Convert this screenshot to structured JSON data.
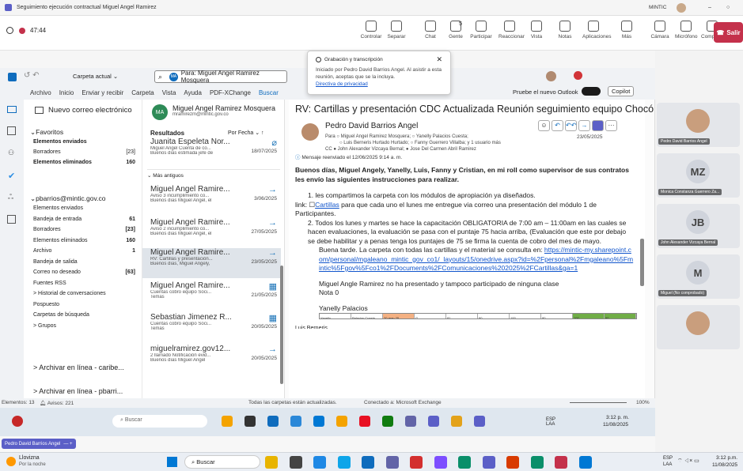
{
  "window_title": "Seguimiento ejecución contractual Miguel Angel Ramirez",
  "window_controls": {
    "app": "MINTIC",
    "min": "–",
    "close": "○"
  },
  "call_timer": "47:44",
  "toolbar": [
    {
      "label": "Controlar",
      "icon": "control-icon"
    },
    {
      "label": "Separar",
      "icon": "pop-out-icon"
    },
    {
      "label": "Chat",
      "icon": "chat-icon"
    },
    {
      "label": "Gente",
      "icon": "people-icon"
    },
    {
      "label": "Participar",
      "icon": "raise-hand-icon"
    },
    {
      "label": "Reaccionar",
      "icon": "react-icon"
    },
    {
      "label": "Vista",
      "icon": "view-icon"
    },
    {
      "label": "Notas",
      "icon": "notes-icon"
    },
    {
      "label": "Aplicaciones",
      "icon": "apps-icon"
    },
    {
      "label": "Más",
      "icon": "more-icon"
    },
    {
      "label": "Cámara",
      "icon": "camera-icon"
    },
    {
      "label": "Micrófono",
      "icon": "mic-icon"
    },
    {
      "label": "Comparte",
      "icon": "share-icon"
    }
  ],
  "people_count": "5",
  "leave_label": "Salir",
  "toast": {
    "title": "Grabación y transcripción",
    "body": "Iniciado por Pedro David Barrios Angel. Al asistir a esta reunión, aceptas que se la incluya.",
    "link": "Directiva de privacidad"
  },
  "outlook": {
    "folder_selector": "Carpeta actual",
    "search_chip": "Para: Miguel Angel Ramirez Mosquera",
    "menu": [
      "Archivo",
      "Inicio",
      "Enviar y recibir",
      "Carpeta",
      "Vista",
      "Ayuda",
      "PDF-XChange",
      "Buscar"
    ],
    "try_new": "Pruebe el nuevo Outlook",
    "copilot": "Copilot",
    "new_mail": "Nuevo correo electrónico",
    "favorites_header": "Favoritos",
    "favorites": [
      {
        "name": "Elementos enviados",
        "count": "",
        "bold": true
      },
      {
        "name": "Borradores",
        "count": "[23]",
        "bold": false
      },
      {
        "name": "Elementos eliminados",
        "count": "160",
        "bold": true
      }
    ],
    "account_header": "pbarrios@mintic.gov.co",
    "account_folders": [
      {
        "name": "Elementos enviados",
        "count": ""
      },
      {
        "name": "Bandeja de entrada",
        "count": "61"
      },
      {
        "name": "Borradores",
        "count": "[23]"
      },
      {
        "name": "Elementos eliminados",
        "count": "160"
      },
      {
        "name": "Archivo",
        "count": "1"
      },
      {
        "name": "Bandeja de salida",
        "count": ""
      },
      {
        "name": "Correo no deseado",
        "count": "[63]"
      },
      {
        "name": "Fuentes RSS",
        "count": ""
      },
      {
        "name": "> Historial de conversaciones",
        "count": ""
      },
      {
        "name": "Pospuesto",
        "count": ""
      },
      {
        "name": "Carpetas de búsqueda",
        "count": ""
      },
      {
        "name": "> Grupos",
        "count": ""
      }
    ],
    "archive_links": [
      "> Archivar en línea - caribe...",
      "> Archivar en línea - pbarri..."
    ],
    "contact_card": {
      "initials": "MA",
      "name": "Miguel Angel Ramirez Mosquera",
      "email": "mramirezm@mintic.gov.co"
    },
    "results_label": "Resultados",
    "sort_label": "Por Fecha",
    "older_label": "Más antiguos",
    "messages": [
      {
        "from": "Juanita Espeleta Nor...",
        "subject": "Miguel Angel Cuenta de co...",
        "preview": "Buenos días estimada jefe de",
        "date": "18/07/2025",
        "icon": "attachment-icon"
      },
      {
        "from": "Miguel Angel Ramire...",
        "subject": "Aviso 3 incumplimiento co...",
        "preview": "Buenos días Miguel Angel, el",
        "date": "3/06/2025",
        "icon": "forward-icon"
      },
      {
        "from": "Miguel Angel Ramire...",
        "subject": "Aviso 2 incumplimiento co...",
        "preview": "Buenos días Miguel Angel, el",
        "date": "27/05/2025",
        "icon": "forward-icon"
      },
      {
        "from": "Miguel Angel Ramire...",
        "subject": "RV: Cartillas y presentación...",
        "preview": "Buenos días, Miguel Angely,",
        "date": "23/05/2025",
        "icon": "forward-icon"
      },
      {
        "from": "Miguel Angel Ramire...",
        "subject": "Cuentas cobro equipo Soci...",
        "preview": "Temas",
        "date": "21/05/2025",
        "icon": "calendar-icon"
      },
      {
        "from": "Sebastian Jimenez R...",
        "subject": "Cuentas cobro equipo Soci...",
        "preview": "Temas",
        "date": "20/05/2025",
        "icon": "calendar-icon"
      },
      {
        "from": "miguelramirez.gov12...",
        "subject": "2 llamado Notificación evid...",
        "preview": "Buenos días Miguel Angel",
        "date": "20/05/2025",
        "icon": "forward-icon"
      }
    ],
    "reading": {
      "subject": "RV: Cartillas y presentación CDC Actualizada Reunión seguimiento equipo Chocó",
      "sender": "Pedro David Barrios Angel",
      "to": "Para  ○ Miguel Angel Ramirez Mosquera; ○ Yanelly Palacios Cuesta;",
      "to2": "○ Luis Berneris Hurtado Hurtado; ○ Fanny Guerrero Villalba; y 1 usuario más",
      "cc": "CC  ● John Alexander Vizcaya Bernal; ● Jose Del Carmen Abril Ramirez",
      "date": "23/05/2025",
      "forwarded": "Mensaje reenviado el 12/06/2025 9:14 a. m.",
      "greeting": "Buenos días, Miguel Angely, Yanelly, Luis, Fanny y Cristian, en mi roll como supervisor de sus contratos les envío las siguientes instrucciones para realizar.",
      "item1": "1.   les compartimos la carpeta con los módulos de apropiación ya diseñados.",
      "link_prefix": "link: ",
      "link_text": "Cartillas",
      "link_suffix": " para que cada uno el lunes me entregue via correo una presentación del módulo 1 de Participantes.",
      "item2": "2.   Todos los lunes y martes se hace la capacitación OBLIGATORIA de 7:00 am – 11:00am en las cuales se hacen evaluaciones, la evaluación se pasa con el puntaje 75 hacia arriba, (Evaluación que este por debajo se debe habilitar y a penas tenga los puntajes de 75 se firma la cuenta de cobro del mes de mayo.",
      "afternoon": "Buena tarde. La carpeta con todas las cartillas y el material se consulta en: ",
      "url": "https://mintic-my.sharepoint.com/personal/mgaleano_mintic_gov_co1/_layouts/15/onedrive.aspx?id=%2Fpersonal%2Fmgaleano%5Fmintic%5Fgov%5Fco1%2FDocuments%2FComunicaciones%202025%2FCartillas&ga=1",
      "no_presented": "Miguel Angle Ramirez no ha presentado y tampoco participado de ninguna clase",
      "grade": "Nota 0",
      "yanelly": "Yanelly Palacios",
      "luis": "Luis Berneris",
      "mini_table": [
        "Yanelly",
        "Palacios Cuesta",
        "20-may-25",
        "G",
        "81",
        "90",
        "100",
        "80",
        "100",
        "90"
      ]
    },
    "status": {
      "items": "Elementos: 13",
      "alerts": "Avisos: 221",
      "sync": "Todas las carpetas están actualizadas.",
      "conn": "Conectado a: Microsoft Exchange",
      "zoom": "100%"
    },
    "inner_taskbar": {
      "search": "Buscar",
      "lang": "ESP LAA",
      "time": "3:12 p. m.",
      "date": "11/08/2025"
    }
  },
  "participants": [
    {
      "name": "Pedro David Barrios Angel",
      "initials": "",
      "photo": true
    },
    {
      "name": "Monica Constanza Guerrero Za...",
      "initials": "MZ",
      "photo": false
    },
    {
      "name": "John Alexander Vizcaya Bernal",
      "initials": "JB",
      "photo": false
    },
    {
      "name": "Miguel (No comprobado)",
      "initials": "M",
      "photo": false
    },
    {
      "name": "",
      "initials": "",
      "photo": true
    }
  ],
  "presenter_pill": "Pedro David Barrios Angel",
  "taskbar": {
    "weather": "Llovizna",
    "weather_sub": "Por la noche",
    "search": "Buscar",
    "lang": "ESP",
    "lang2": "LAA",
    "time": "3:12 p.m.",
    "date": "11/08/2025"
  },
  "colors": {
    "accent": "#0f6cbd",
    "leave": "#c4314b",
    "teams": "#5b5fc7"
  }
}
